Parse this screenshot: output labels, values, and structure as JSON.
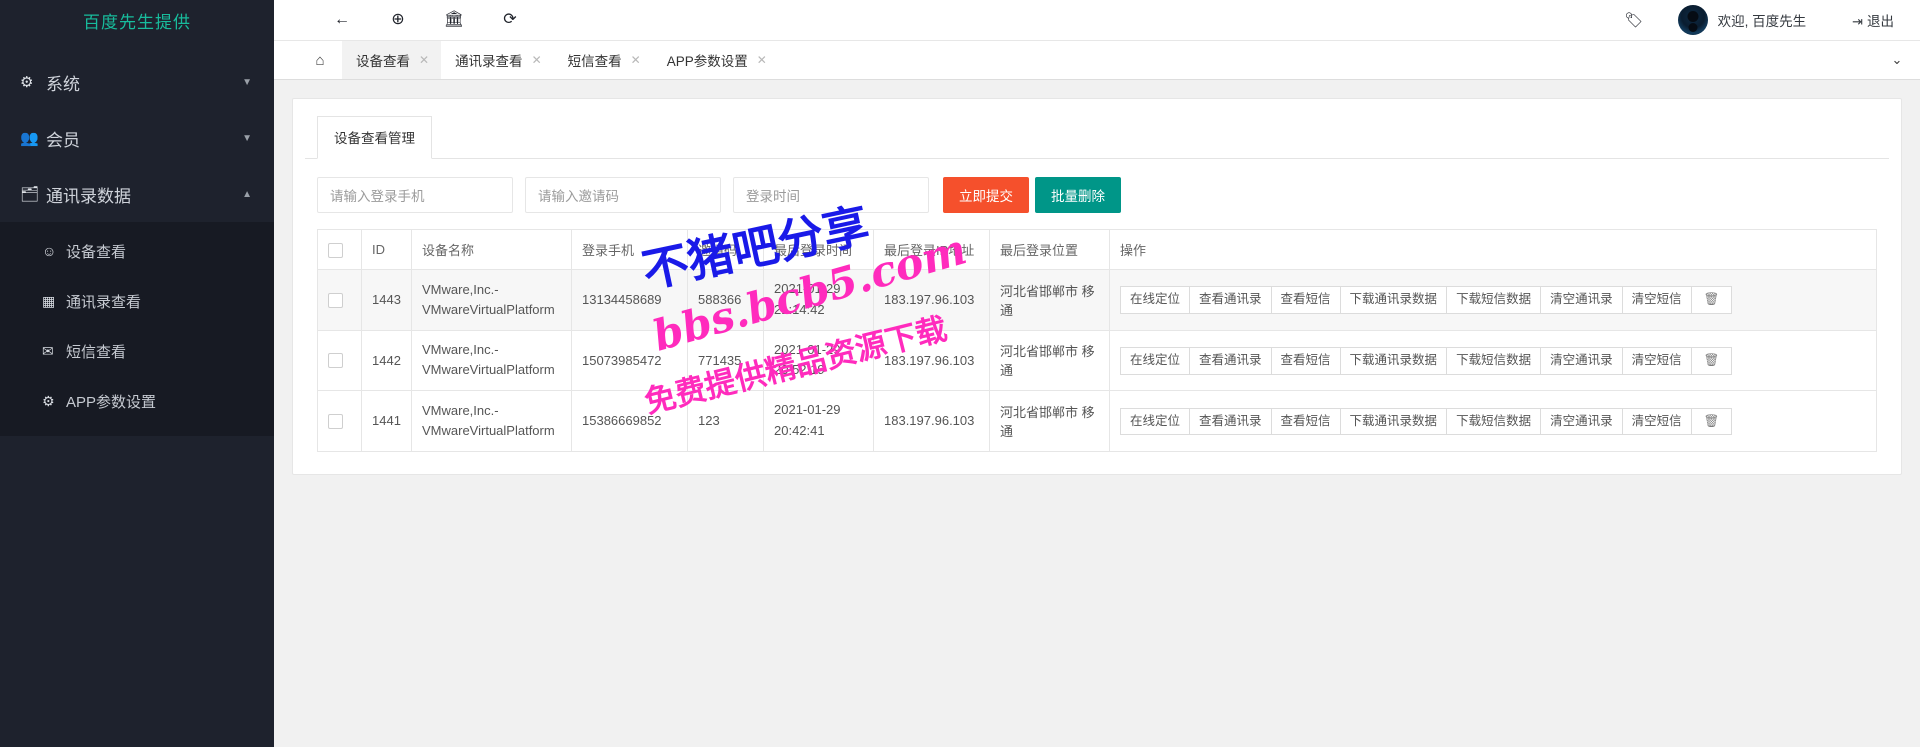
{
  "sidebar": {
    "brand": "百度先生提供",
    "groups": [
      {
        "icon": "gear-icon",
        "glyph": "⚙",
        "label": "系统",
        "caret": "▼",
        "open": false
      },
      {
        "icon": "users-icon",
        "glyph": "👥",
        "label": "会员",
        "caret": "▼",
        "open": false
      },
      {
        "icon": "id-card-icon",
        "glyph": "🪪",
        "label": "通讯录数据",
        "caret": "▲",
        "open": true
      }
    ],
    "submenu": [
      {
        "icon": "user-circle-icon",
        "glyph": "👤",
        "label": "设备查看"
      },
      {
        "icon": "book-icon",
        "glyph": "▤",
        "label": "通讯录查看"
      },
      {
        "icon": "envelope-icon",
        "glyph": "✉",
        "label": "短信查看"
      },
      {
        "icon": "gear-icon",
        "glyph": "⚙",
        "label": "APP参数设置"
      }
    ]
  },
  "topbar": {
    "tools": [
      {
        "name": "back-arrow-icon",
        "glyph": "←"
      },
      {
        "name": "globe-icon",
        "glyph": "⊕"
      },
      {
        "name": "bank-icon",
        "glyph": "🏛"
      },
      {
        "name": "refresh-icon",
        "glyph": "⟳"
      }
    ],
    "tag_icon": "🏷",
    "welcome": "欢迎, 百度先生",
    "logout_icon": "⇥",
    "logout": "退出"
  },
  "tabs": {
    "home_icon": "⌂",
    "items": [
      {
        "label": "设备查看",
        "active": true,
        "closable": true
      },
      {
        "label": "通讯录查看",
        "active": false,
        "closable": true
      },
      {
        "label": "短信查看",
        "active": false,
        "closable": true
      },
      {
        "label": "APP参数设置",
        "active": false,
        "closable": true
      }
    ],
    "collapse_icon": "⌄"
  },
  "card": {
    "tab_label": "设备查看管理",
    "search": {
      "phone_placeholder": "请输入登录手机",
      "invite_placeholder": "请输入邀请码",
      "time_placeholder": "登录时间",
      "submit_label": "立即提交",
      "batch_delete_label": "批量删除",
      "submit_color": "#f5502c",
      "batch_color": "#009688"
    },
    "table": {
      "columns": [
        "",
        "ID",
        "设备名称",
        "登录手机",
        "邀请码",
        "最后登录时间",
        "最后登录IP地址",
        "最后登录位置",
        "操作"
      ],
      "rows": [
        {
          "id": "1443",
          "device": "VMware,Inc.-VMwareVirtualPlatform",
          "phone": "13134458689",
          "invite": "588366",
          "time_date": "2021-01-29",
          "time_clock": "21:14:42",
          "ip": "183.197.96.103",
          "location": "河北省邯郸市 移通"
        },
        {
          "id": "1442",
          "device": "VMware,Inc.-VMwareVirtualPlatform",
          "phone": "15073985472",
          "invite": "771435",
          "time_date": "2021-01-29",
          "time_clock": "20:52:19",
          "ip": "183.197.96.103",
          "location": "河北省邯郸市 移通"
        },
        {
          "id": "1441",
          "device": "VMware,Inc.-VMwareVirtualPlatform",
          "phone": "15386669852",
          "invite": "123",
          "time_date": "2021-01-29",
          "time_clock": "20:42:41",
          "ip": "183.197.96.103",
          "location": "河北省邯郸市 移通"
        }
      ],
      "actions": [
        "在线定位",
        "查看通讯录",
        "查看短信",
        "下载通讯录数据",
        "下载短信数据",
        "清空通讯录",
        "清空短信"
      ],
      "delete_icon": "🗑"
    }
  },
  "watermarks": {
    "line1": "不猪吧分享",
    "line2": "bbs.bcb5.com",
    "line3": "免费提供精品资源下载",
    "color_blue": "#1a1ae8",
    "color_pink": "#ff2bbd"
  }
}
